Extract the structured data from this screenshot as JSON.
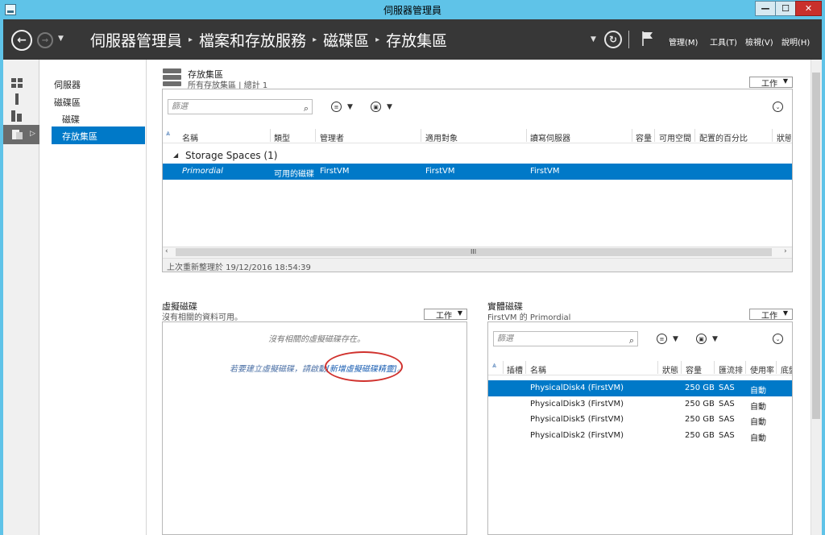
{
  "window": {
    "title": "伺服器管理員",
    "min_glyph": "—",
    "max_glyph": "☐",
    "close_glyph": "✕"
  },
  "header": {
    "breadcrumb": [
      "伺服器管理員",
      "檔案和存放服務",
      "磁碟區",
      "存放集區"
    ],
    "menus": [
      "管理(M)",
      "工具(T)",
      "檢視(V)",
      "說明(H)"
    ]
  },
  "nav": {
    "items": [
      "伺服器",
      "磁碟區",
      "磁碟",
      "存放集區"
    ],
    "selected": "存放集區"
  },
  "storage_pools": {
    "title": "存放集區",
    "subtitle": "所有存放集區 | 總計 1",
    "tasks_label": "工作",
    "filter_placeholder": "篩選",
    "columns": [
      "名稱",
      "類型",
      "管理者",
      "適用對象",
      "讀寫伺服器",
      "容量",
      "可用空間",
      "配置的百分比",
      "狀態"
    ],
    "group": "Storage Spaces (1)",
    "rows": [
      {
        "name": "Primordial",
        "type": "可用的磁碟",
        "managed_by": "FirstVM",
        "available_to": "FirstVM",
        "rw_server": "FirstVM"
      }
    ],
    "scroll_label": "III",
    "footer": "上次重新整理於 19/12/2016 18:54:39"
  },
  "virtual_disks": {
    "title": "虛擬磁碟",
    "subtitle": "沒有相關的資料可用。",
    "tasks_label": "工作",
    "empty_message": "沒有相關的虛擬磁碟存在。",
    "hint_prefix": "若要建立虛擬磁碟，請啟動",
    "hint_link": "[新增虛擬磁碟精靈]",
    "hint_suffix": "。"
  },
  "physical_disks": {
    "title": "實體磁碟",
    "subtitle": "FirstVM 的 Primordial",
    "tasks_label": "工作",
    "filter_placeholder": "篩選",
    "columns": [
      "插槽",
      "名稱",
      "狀態",
      "容量",
      "匯流排",
      "使用率",
      "底盤"
    ],
    "rows": [
      {
        "name": "PhysicalDisk4 (FirstVM)",
        "capacity": "250 GB",
        "bus": "SAS",
        "usage": "自動"
      },
      {
        "name": "PhysicalDisk3 (FirstVM)",
        "capacity": "250 GB",
        "bus": "SAS",
        "usage": "自動"
      },
      {
        "name": "PhysicalDisk5 (FirstVM)",
        "capacity": "250 GB",
        "bus": "SAS",
        "usage": "自動"
      },
      {
        "name": "PhysicalDisk2 (FirstVM)",
        "capacity": "250 GB",
        "bus": "SAS",
        "usage": "自動"
      }
    ]
  },
  "colors": {
    "accent": "#0079c8",
    "header_bg": "#373737",
    "chrome": "#5fc3e8",
    "annotation": "#d0312d"
  }
}
